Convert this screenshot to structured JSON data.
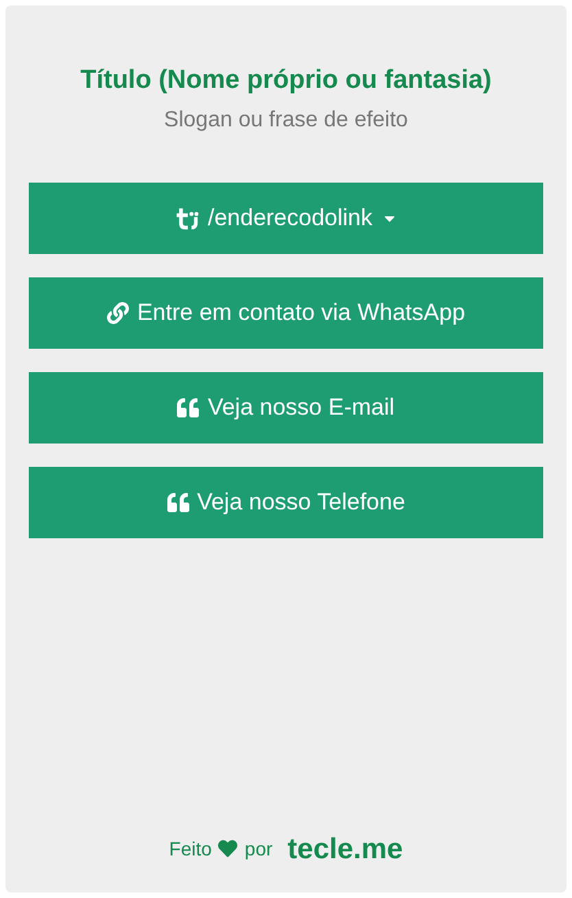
{
  "header": {
    "title": "Título (Nome próprio ou fantasia)",
    "slogan": "Slogan ou frase de efeito"
  },
  "buttons": [
    {
      "kind": "address",
      "label": "/enderecodolink"
    },
    {
      "kind": "link",
      "label": "Entre em contato via WhatsApp"
    },
    {
      "kind": "quote",
      "label": "Veja nosso E-mail"
    },
    {
      "kind": "quote",
      "label": "Veja nosso Telefone"
    }
  ],
  "footer": {
    "made": "Feito",
    "by": "por",
    "brand": "tecle.me"
  }
}
